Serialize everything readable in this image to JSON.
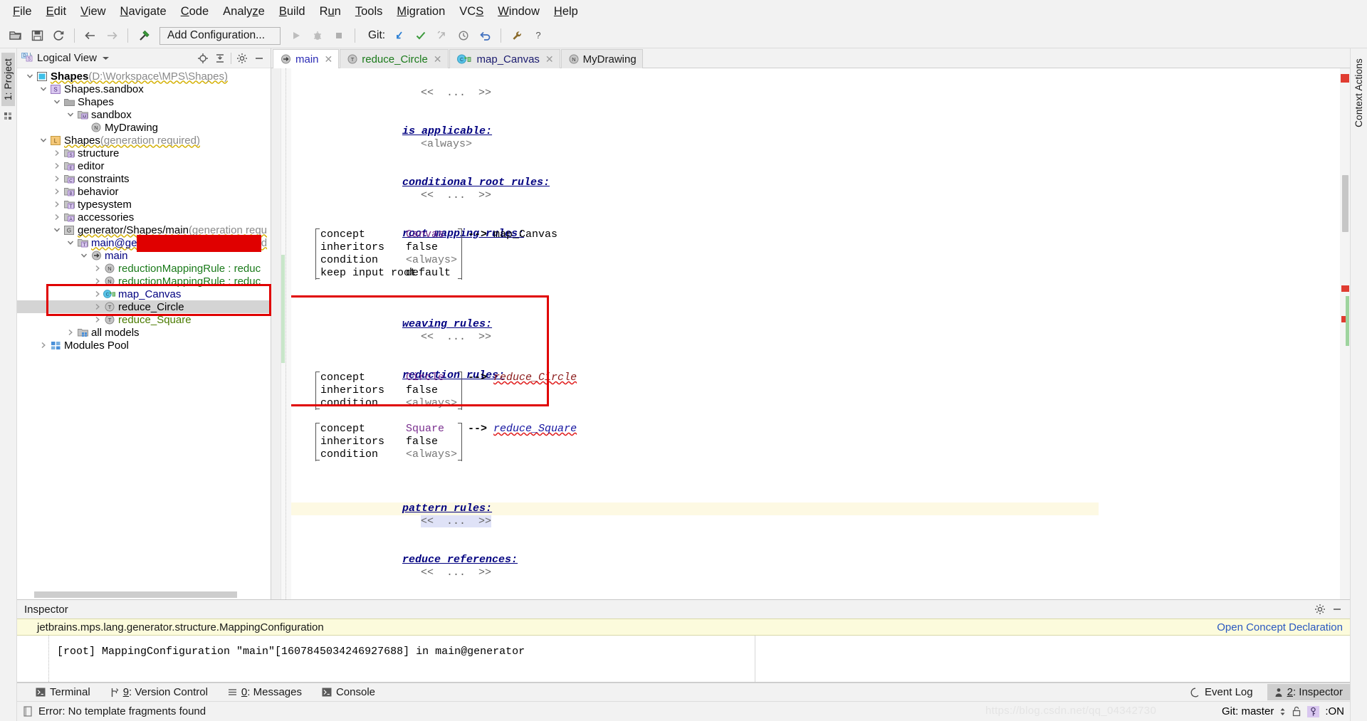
{
  "menubar": {
    "items": [
      {
        "label": "File",
        "mnemonic": "F"
      },
      {
        "label": "Edit",
        "mnemonic": "E"
      },
      {
        "label": "View",
        "mnemonic": "V"
      },
      {
        "label": "Navigate",
        "mnemonic": "N"
      },
      {
        "label": "Code",
        "mnemonic": "C"
      },
      {
        "label": "Analyze",
        "mnemonic": "z"
      },
      {
        "label": "Build",
        "mnemonic": "B"
      },
      {
        "label": "Run",
        "mnemonic": "u"
      },
      {
        "label": "Tools",
        "mnemonic": "T"
      },
      {
        "label": "Migration",
        "mnemonic": "M"
      },
      {
        "label": "VCS",
        "mnemonic": "S"
      },
      {
        "label": "Window",
        "mnemonic": "W"
      },
      {
        "label": "Help",
        "mnemonic": "H"
      }
    ]
  },
  "toolbar": {
    "open_icon": "folder-open-icon",
    "save_icon": "save-icon",
    "sync_icon": "refresh-icon",
    "back_icon": "arrow-left-icon",
    "forward_icon": "arrow-right-icon",
    "build_icon": "hammer-icon",
    "run_config_label": "Add Configuration...",
    "run_icon": "run-icon",
    "debug_icon": "debug-icon",
    "stop_icon": "stop-icon",
    "git_label": "Git:",
    "update_icon": "update-project-icon",
    "commit_icon": "commit-checkmark-icon",
    "push_icon": "push-icon",
    "history_icon": "history-clock-icon",
    "rollback_icon": "rollback-icon",
    "settings_icon": "wrench-icon",
    "help_icon": "help-question-icon"
  },
  "left_strip": {
    "tabs": [
      {
        "label": "1: Project",
        "active": true
      }
    ],
    "structure_tab": "structure-icon"
  },
  "right_strip": {
    "tabs": [
      {
        "label": "Context Actions",
        "active": false
      }
    ]
  },
  "project_panel": {
    "view_selector": "Logical View",
    "view_icon": "logical-view-icon",
    "chevron_icon": "chevron-down-icon",
    "locate_icon": "scroll-from-source-icon",
    "collapse_icon": "collapse-all-icon",
    "settings_icon": "gear-icon",
    "hide_icon": "hide-panel-icon",
    "tree": [
      {
        "indent": 0,
        "twisty": "down",
        "icon": "project-icon",
        "label": "Shapes",
        "bold": true,
        "suffix": " (D:\\Workspace\\MPS\\Shapes)",
        "wavy": true,
        "color": "black"
      },
      {
        "indent": 1,
        "twisty": "down",
        "icon": "solution-icon",
        "icon_letter": "S",
        "label": "Shapes.sandbox",
        "color": "black"
      },
      {
        "indent": 2,
        "twisty": "down",
        "icon": "folder-icon",
        "label": "Shapes",
        "color": "black"
      },
      {
        "indent": 3,
        "twisty": "down",
        "icon": "model-icon",
        "icon_letter": "M",
        "label": "sandbox",
        "color": "black"
      },
      {
        "indent": 4,
        "twisty": "none",
        "icon": "node-icon",
        "icon_letter": "N",
        "label": "MyDrawing",
        "color": "black"
      },
      {
        "indent": 1,
        "twisty": "down",
        "icon": "language-icon",
        "icon_letter": "L",
        "label": "Shapes",
        "suffix": " (generation required)",
        "wavy": true,
        "color": "black"
      },
      {
        "indent": 2,
        "twisty": "right",
        "icon": "model-icon",
        "icon_letter": "S",
        "label": "structure",
        "color": "black"
      },
      {
        "indent": 2,
        "twisty": "right",
        "icon": "model-icon",
        "icon_letter": "E",
        "label": "editor",
        "color": "black"
      },
      {
        "indent": 2,
        "twisty": "right",
        "icon": "model-icon",
        "icon_letter": "C",
        "label": "constraints",
        "color": "black"
      },
      {
        "indent": 2,
        "twisty": "right",
        "icon": "model-icon",
        "icon_letter": "B",
        "label": "behavior",
        "color": "black"
      },
      {
        "indent": 2,
        "twisty": "right",
        "icon": "model-icon",
        "icon_letter": "T",
        "label": "typesystem",
        "color": "black"
      },
      {
        "indent": 2,
        "twisty": "right",
        "icon": "model-icon",
        "icon_letter": "A",
        "label": "accessories",
        "color": "black"
      },
      {
        "indent": 2,
        "twisty": "down",
        "icon": "generator-icon",
        "icon_letter": "G",
        "label": "generator/Shapes/main",
        "suffix": " (generation requ",
        "wavy": true,
        "color": "black"
      },
      {
        "indent": 3,
        "twisty": "down",
        "icon": "model-icon",
        "icon_letter": "T",
        "label": "main@generator",
        "suffix": " (generation required",
        "color": "blue",
        "wavy": true
      },
      {
        "indent": 4,
        "twisty": "down",
        "icon": "mapping-config-icon",
        "label": "main",
        "color": "blue"
      },
      {
        "indent": 5,
        "twisty": "right",
        "icon": "node-icon",
        "icon_letter": "N",
        "label": "reductionMappingRule : reduc",
        "color": "green"
      },
      {
        "indent": 5,
        "twisty": "right",
        "icon": "node-icon",
        "icon_letter": "N",
        "label": "reductionMappingRule : reduc",
        "color": "green"
      },
      {
        "indent": 5,
        "twisty": "right",
        "icon": "canvas-template-icon",
        "label": "map_Canvas",
        "color": "blue"
      },
      {
        "indent": 5,
        "twisty": "right",
        "icon": "template-icon",
        "icon_letter": "T",
        "label": "reduce_Circle",
        "color": "black",
        "selected": true
      },
      {
        "indent": 5,
        "twisty": "right",
        "icon": "template-icon",
        "icon_letter": "T",
        "label": "reduce_Square",
        "color": "olive"
      },
      {
        "indent": 3,
        "twisty": "right",
        "icon": "all-models-icon",
        "label": "all models",
        "color": "black"
      },
      {
        "indent": 1,
        "twisty": "right",
        "icon": "modules-pool-icon",
        "label": "Modules Pool",
        "color": "black"
      }
    ]
  },
  "editor": {
    "tabs": [
      {
        "label": "main",
        "icon": "mapping-config-icon",
        "color": "blue",
        "active": true,
        "closable": true
      },
      {
        "label": "reduce_Circle",
        "icon": "template-icon",
        "icon_letter": "T",
        "color": "green",
        "active": false,
        "closable": true
      },
      {
        "label": "map_Canvas",
        "icon": "canvas-template-icon",
        "icon_letter": "C",
        "color": "navy",
        "active": false,
        "closable": true
      },
      {
        "label": "MyDrawing",
        "icon": "node-icon",
        "icon_letter": "N",
        "color": "plain",
        "active": false,
        "closable": false
      }
    ],
    "content": {
      "top_ellipsis": "<<  ...  >>",
      "sections": [
        {
          "id": "is_applicable",
          "header": "is applicable:",
          "value": "<always>"
        },
        {
          "id": "conditional_root_rules",
          "header": "conditional root rules:",
          "value": "<<  ...  >>"
        },
        {
          "id": "root_mapping_rules",
          "header": "root mapping rules:"
        },
        {
          "id": "weaving_rules",
          "header": "weaving rules:",
          "value": "<<  ...  >>"
        },
        {
          "id": "reduction_rules",
          "header": "reduction rules:"
        },
        {
          "id": "pattern_rules",
          "header": "pattern rules:",
          "value": "<<  ...  >>"
        },
        {
          "id": "reduce_references",
          "header": "reduce references:",
          "value": "<<  ...  >>"
        }
      ],
      "root_mapping_rule": {
        "rows": [
          {
            "key": "concept",
            "value": "Canvas",
            "kind": "concept"
          },
          {
            "key": "inheritors",
            "value": "false",
            "kind": "plain"
          },
          {
            "key": "condition",
            "value": "<always>",
            "kind": "gray"
          },
          {
            "key": "keep input root",
            "value": "default",
            "kind": "plain",
            "wide": true
          }
        ],
        "arrow": "-->",
        "target": "map_Canvas",
        "target_style": "plain"
      },
      "reduction_rules": [
        {
          "rows": [
            {
              "key": "concept",
              "value": "Circle",
              "kind": "concept"
            },
            {
              "key": "inheritors",
              "value": "false",
              "kind": "plain"
            },
            {
              "key": "condition",
              "value": "<always>",
              "kind": "gray"
            }
          ],
          "arrow": "-->",
          "target": "reduce_Circle",
          "target_style": "red",
          "error": true
        },
        {
          "rows": [
            {
              "key": "concept",
              "value": "Square",
              "kind": "concept"
            },
            {
              "key": "inheritors",
              "value": "false",
              "kind": "plain"
            },
            {
              "key": "condition",
              "value": "<always>",
              "kind": "gray"
            }
          ],
          "arrow": "-->",
          "target": "reduce_Square",
          "target_style": "navy",
          "error": true
        }
      ]
    }
  },
  "inspector": {
    "title": "Inspector",
    "settings_icon": "gear-icon",
    "minimize_icon": "minimize-icon",
    "path": "jetbrains.mps.lang.generator.structure.MappingConfiguration",
    "open_concept_link": "Open Concept Declaration",
    "code": "[root] MappingConfiguration \"main\"[1607845034246927688] in main@generator"
  },
  "toolstrip": {
    "items": [
      {
        "label": "Terminal",
        "icon": "terminal-icon",
        "mnemonic": ""
      },
      {
        "label": "9: Version Control",
        "icon": "vcs-branch-icon",
        "mnemonic": "9"
      },
      {
        "label": "0: Messages",
        "icon": "messages-icon",
        "mnemonic": "0"
      },
      {
        "label": "Console",
        "icon": "console-icon",
        "mnemonic": ""
      }
    ],
    "right_items": [
      {
        "label": "Event Log",
        "icon": "event-log-icon",
        "active": false
      },
      {
        "label": "2: Inspector",
        "icon": "inspector-icon",
        "active": true,
        "mnemonic": "2"
      }
    ]
  },
  "statusbar": {
    "message_icon": "document-icon",
    "message": "Error: No template fragments found",
    "git_branch": "Git: master",
    "branch_chevron_icon": "updown-chevron-icon",
    "lock_icon": "unlock-icon",
    "lock_badge_icon": "key-icon",
    "lock_state": ":ON",
    "watermark": "https://blog.csdn.net/qq_04342730"
  },
  "colors": {
    "accent_blue": "#2b2bb5",
    "error_red": "#e00000",
    "section_navy": "#000080",
    "concept_purple": "#7a2f8f",
    "tree_green": "#1a7a1a",
    "highlight_yellow": "#fcfbdc"
  }
}
